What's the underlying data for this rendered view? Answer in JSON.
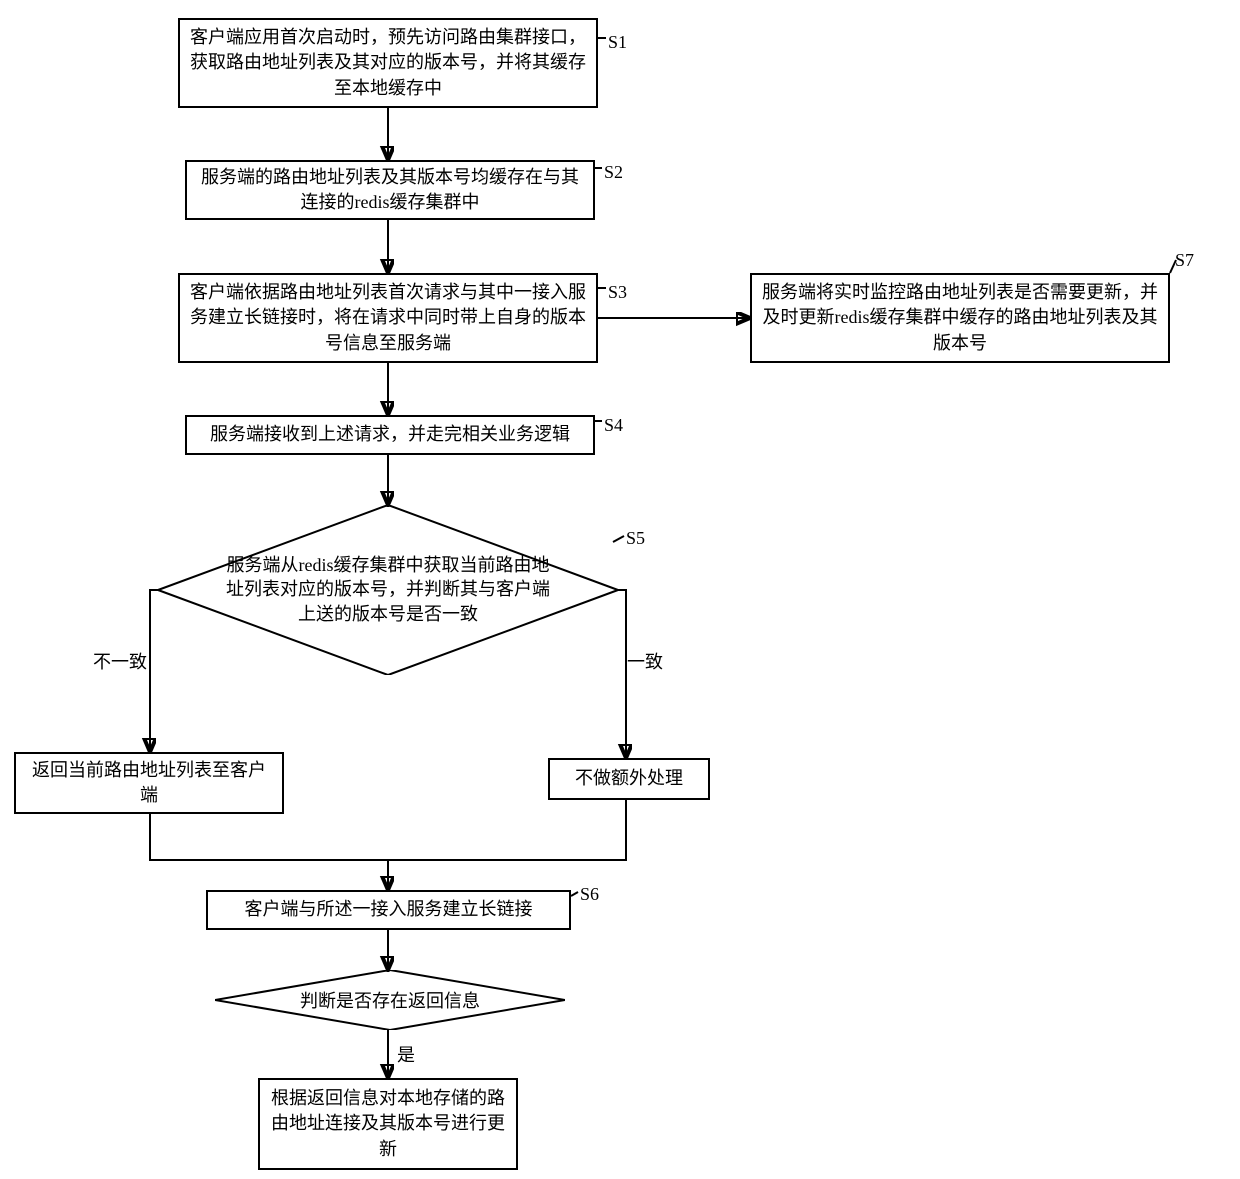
{
  "steps": {
    "s1": {
      "label": "S1",
      "text": "客户端应用首次启动时，预先访问路由集群接口，获取路由地址列表及其对应的版本号，并将其缓存至本地缓存中"
    },
    "s2": {
      "label": "S2",
      "text": "服务端的路由地址列表及其版本号均缓存在与其连接的redis缓存集群中"
    },
    "s3": {
      "label": "S3",
      "text": "客户端依据路由地址列表首次请求与其中一接入服务建立长链接时，将在请求中同时带上自身的版本号信息至服务端"
    },
    "s4": {
      "label": "S4",
      "text": "服务端接收到上述请求，并走完相关业务逻辑"
    },
    "s5": {
      "label": "S5",
      "text": "服务端从redis缓存集群中获取当前路由地址列表对应的版本号，并判断其与客户端上送的版本号是否一致"
    },
    "s6": {
      "label": "S6",
      "text": "客户端与所述一接入服务建立长链接"
    },
    "s7": {
      "label": "S7",
      "text": "服务端将实时监控路由地址列表是否需要更新，并及时更新redis缓存集群中缓存的路由地址列表及其版本号"
    }
  },
  "branches": {
    "no_match": "不一致",
    "match": "一致",
    "yes": "是"
  },
  "results": {
    "return_list": "返回当前路由地址列表至客户端",
    "no_extra": "不做额外处理"
  },
  "decision2": "判断是否存在返回信息",
  "final_step": "根据返回信息对本地存储的路由地址连接及其版本号进行更新"
}
